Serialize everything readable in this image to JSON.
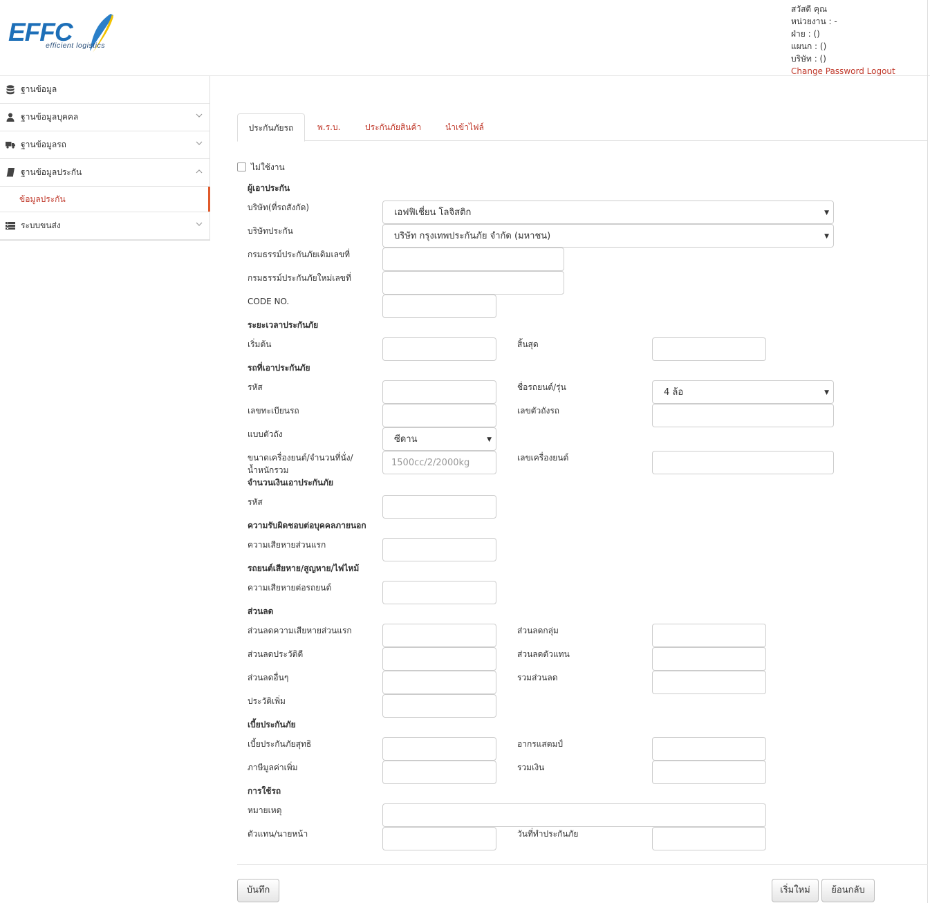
{
  "logo": {
    "brand": "EFFC",
    "tagline": "efficient logistics"
  },
  "user": {
    "greeting": "สวัสดี คุณ",
    "unit": "หน่วยงาน : -",
    "division": "ฝ่าย : ()",
    "department": "แผนก : ()",
    "company": "บริษัท : ()",
    "change_password": "Change Password",
    "logout": "Logout"
  },
  "sidebar": {
    "items": [
      {
        "label": "ฐานข้อมูล",
        "icon": "database-icon"
      },
      {
        "label": "ฐานข้อมูลบุคคล",
        "icon": "user-icon"
      },
      {
        "label": "ฐานข้อมูลรถ",
        "icon": "truck-icon"
      },
      {
        "label": "ฐานข้อมูลประกัน",
        "icon": "book-icon"
      },
      {
        "label": "ระบบขนส่ง",
        "icon": "list-icon"
      }
    ],
    "active_sub": "ข้อมูลประกัน"
  },
  "tabs": [
    "ประกันภัยรถ",
    "พ.ร.บ.",
    "ประกันภัยสินค้า",
    "นำเข้าไฟล์"
  ],
  "form": {
    "inactive_label": "ไม่ใช้งาน",
    "insured_section": "ผู้เอาประกัน",
    "company_label": "บริษัท(ที่รถสังกัด)",
    "company_value": "เอฟฟิเชี่ยน โลจิสติก",
    "insurer_label": "บริษัทประกัน",
    "insurer_value": "บริษัท กรุงเทพประกันภัย จำกัด (มหาชน)",
    "old_policy_label": "กรมธรรม์ประกันภัยเดิมเลขที่",
    "new_policy_label": "กรมธรรม์ประกันภัยใหม่เลขที่",
    "code_label": "CODE NO.",
    "period_section": "ระยะเวลาประกันภัย",
    "start_label": "เริ่มต้น",
    "end_label": "สิ้นสุด",
    "vehicle_section": "รถที่เอาประกันภัย",
    "vehicle_code_label": "รหัส",
    "model_label": "ชื่อรถยนต์/รุ่น",
    "model_value": "4 ล้อ",
    "plate_label": "เลขทะเบียนรถ",
    "chassis_label": "เลขตัวถังรถ",
    "body_label": "แบบตัวถัง",
    "body_value": "ซีดาน",
    "engine_size_label_1": "ขนาดเครื่องยนต์/จำนวนที่นั่ง/",
    "engine_size_label_2": "น้ำหนักรวม",
    "engine_size_placeholder": "1500cc/2/2000kg",
    "engine_no_label": "เลขเครื่องยนต์",
    "sum_section": "จำนวนเงินเอาประกันภัย",
    "sum_code_label": "รหัส",
    "liability_section": "ความรับผิดชอบต่อบุคคลภายนอก",
    "first_damage_label": "ความเสียหายส่วนแรก",
    "car_damage_section": "รถยนต์เสียหาย/สูญหาย/ไฟไหม้",
    "damage_per_car_label": "ความเสียหายต่อรถยนต์",
    "discount_section": "ส่วนลด",
    "disc_first_damage_label": "ส่วนลดความเสียหายส่วนแรก",
    "disc_group_label": "ส่วนลดกลุ่ม",
    "disc_history_label": "ส่วนลดประวัติดี",
    "disc_agent_label": "ส่วนลดตัวแทน",
    "disc_other_label": "ส่วนลดอื่นๆ",
    "disc_total_label": "รวมส่วนลด",
    "history_add_label": "ประวัติเพิ่ม",
    "premium_section": "เบี้ยประกันภัย",
    "net_premium_label": "เบี้ยประกันภัยสุทธิ",
    "stamp_label": "อากรแสตมป์",
    "vat_label": "ภาษีมูลค่าเพิ่ม",
    "total_label": "รวมเงิน",
    "usage_section": "การใช้รถ",
    "note_label": "หมายเหตุ",
    "agent_label": "ตัวแทน/นายหน้า",
    "insured_date_label": "วันที่ทำประกันภัย"
  },
  "buttons": {
    "save": "บันทึก",
    "reset": "เริ่มใหม่",
    "back": "ย้อนกลับ"
  }
}
